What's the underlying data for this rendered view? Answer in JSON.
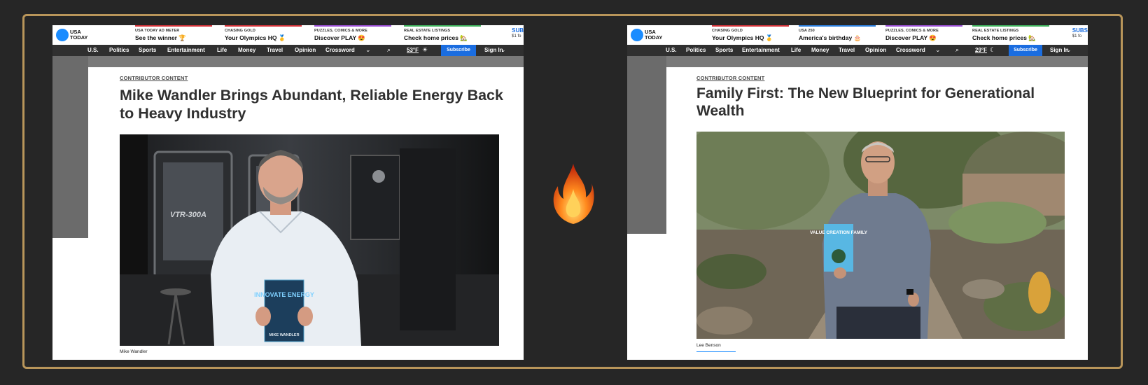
{
  "left": {
    "logo": "USA TODAY",
    "promos": [
      {
        "kicker": "USA TODAY AD METER",
        "text": "See the winner 🏆",
        "color": "#d6333a"
      },
      {
        "kicker": "CHASING GOLD",
        "text": "Your Olympics HQ 🥇",
        "color": "#d6333a"
      },
      {
        "kicker": "PUZZLES, COMICS & MORE",
        "text": "Discover PLAY 😍",
        "color": "#9b4fd6"
      },
      {
        "kicker": "REAL ESTATE LISTINGS",
        "text": "Check home prices 🏡",
        "color": "#3fb35d"
      }
    ],
    "subscribe_promo": "SUB",
    "subscribe_promo_small": "$1 fo",
    "nav": [
      "U.S.",
      "Politics",
      "Sports",
      "Entertainment",
      "Life",
      "Money",
      "Travel",
      "Opinion",
      "Crossword"
    ],
    "temperature": "53°F",
    "subscribe": "Subscribe",
    "signin": "Sign In",
    "kicker": "CONTRIBUTOR CONTENT",
    "headline": "Mike Wandler Brings Abundant, Reliable Energy Back to Heavy Industry",
    "caption": "Mike Wandler",
    "book_title": "INNOVATE ENERGY",
    "book_author": "MIKE WANDLER",
    "machine_label": "VTR-300A"
  },
  "right": {
    "logo": "USA TODAY",
    "promos": [
      {
        "kicker": "CHASING GOLD",
        "text": "Your Olympics HQ 🥇",
        "color": "#d6333a"
      },
      {
        "kicker": "USA 250",
        "text": "America's birthday 🎂",
        "color": "#2b7fe0"
      },
      {
        "kicker": "PUZZLES, COMICS & MORE",
        "text": "Discover PLAY 😍",
        "color": "#9b4fd6"
      },
      {
        "kicker": "REAL ESTATE LISTINGS",
        "text": "Check home prices 🏡",
        "color": "#3fb35d"
      }
    ],
    "subscribe_promo": "SUBS",
    "subscribe_promo_small": "$1 fo",
    "nav": [
      "U.S.",
      "Politics",
      "Sports",
      "Entertainment",
      "Life",
      "Money",
      "Travel",
      "Opinion",
      "Crossword"
    ],
    "temperature": "29°F",
    "subscribe": "Subscribe",
    "signin": "Sign In",
    "kicker": "CONTRIBUTOR CONTENT",
    "headline": "Family First: The New Blueprint for Generational Wealth",
    "caption": "Lee Benson",
    "book_title": "VALUE CREATION FAMILY"
  },
  "colors": {
    "background": "#262626",
    "frame": "#b8955a",
    "subscribe": "#1a6de0",
    "logo": "#1a8cff"
  }
}
